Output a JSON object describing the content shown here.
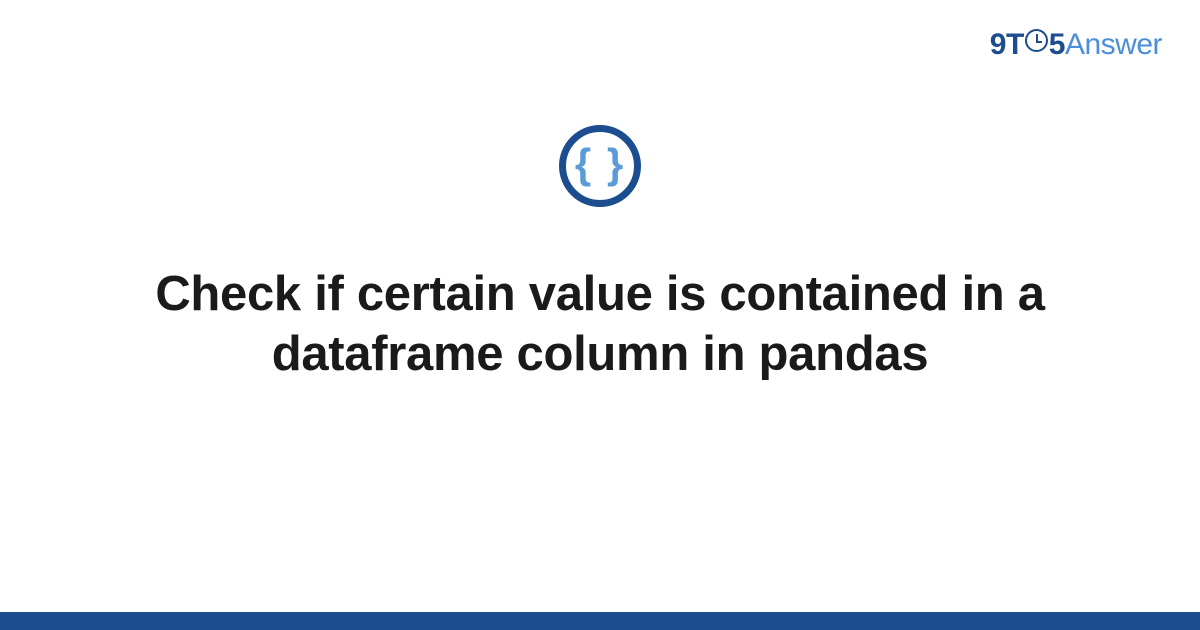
{
  "brand": {
    "nine": "9",
    "t": "T",
    "five": "5",
    "answer": "Answer"
  },
  "icon": {
    "name": "curly-braces-icon",
    "glyph": "{ }"
  },
  "title": "Check if certain value is contained in a dataframe column in pandas",
  "colors": {
    "primary": "#1b4d8f",
    "accent": "#4a8fd8"
  }
}
